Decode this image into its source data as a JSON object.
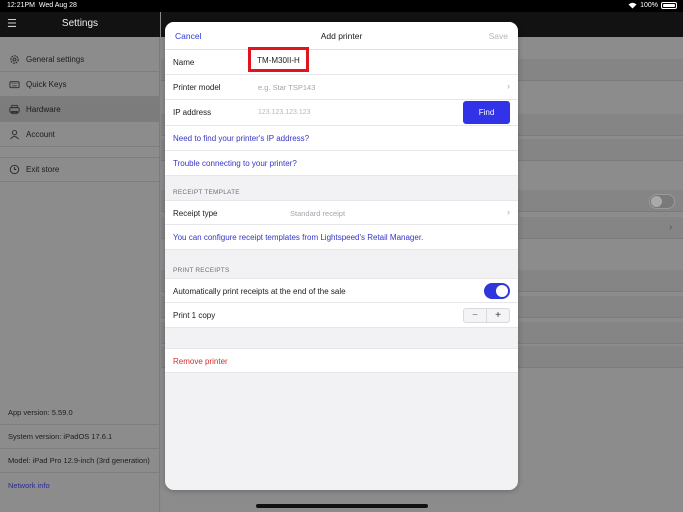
{
  "status_bar": {
    "time": "12:21PM",
    "date": "Wed Aug 28",
    "battery": "100%"
  },
  "sidebar": {
    "title": "Settings",
    "items": [
      {
        "label": "General settings",
        "icon": "gear-icon"
      },
      {
        "label": "Quick Keys",
        "icon": "keyboard-icon"
      },
      {
        "label": "Hardware",
        "icon": "printer-icon",
        "active": true
      },
      {
        "label": "Account",
        "icon": "person-icon"
      }
    ],
    "exit_label": "Exit store",
    "info": {
      "app_version": "App version: 5.59.0",
      "system_version": "System version: iPadOS 17.6.1",
      "model": "Model: iPad Pro 12.9-inch (3rd generation)",
      "network_info": "Network info"
    }
  },
  "modal": {
    "cancel": "Cancel",
    "title": "Add printer",
    "save": "Save",
    "name_label": "Name",
    "name_value": "TM-M30II-H",
    "model_label": "Printer model",
    "model_placeholder": "e.g. Star TSP143",
    "ip_label": "IP address",
    "ip_placeholder": "123.123.123.123",
    "find_button": "Find",
    "help_ip": "Need to find your printer's IP address?",
    "help_trouble": "Trouble connecting to your printer?",
    "receipt_template_section": "RECEIPT TEMPLATE",
    "receipt_type_label": "Receipt type",
    "receipt_type_value": "Standard receipt",
    "receipt_template_link": "You can configure receipt templates from Lightspeed's Retail Manager.",
    "print_receipts_section": "PRINT RECEIPTS",
    "auto_print_label": "Automatically print receipts at the end of the sale",
    "auto_print_enabled": true,
    "print_copies_label": "Print 1 copy",
    "stepper_minus": "−",
    "stepper_plus": "+",
    "remove_printer": "Remove printer"
  },
  "colors": {
    "accent": "#3232e8",
    "link": "#3535c8",
    "danger": "#d1302a",
    "highlight": "#e1141e"
  }
}
